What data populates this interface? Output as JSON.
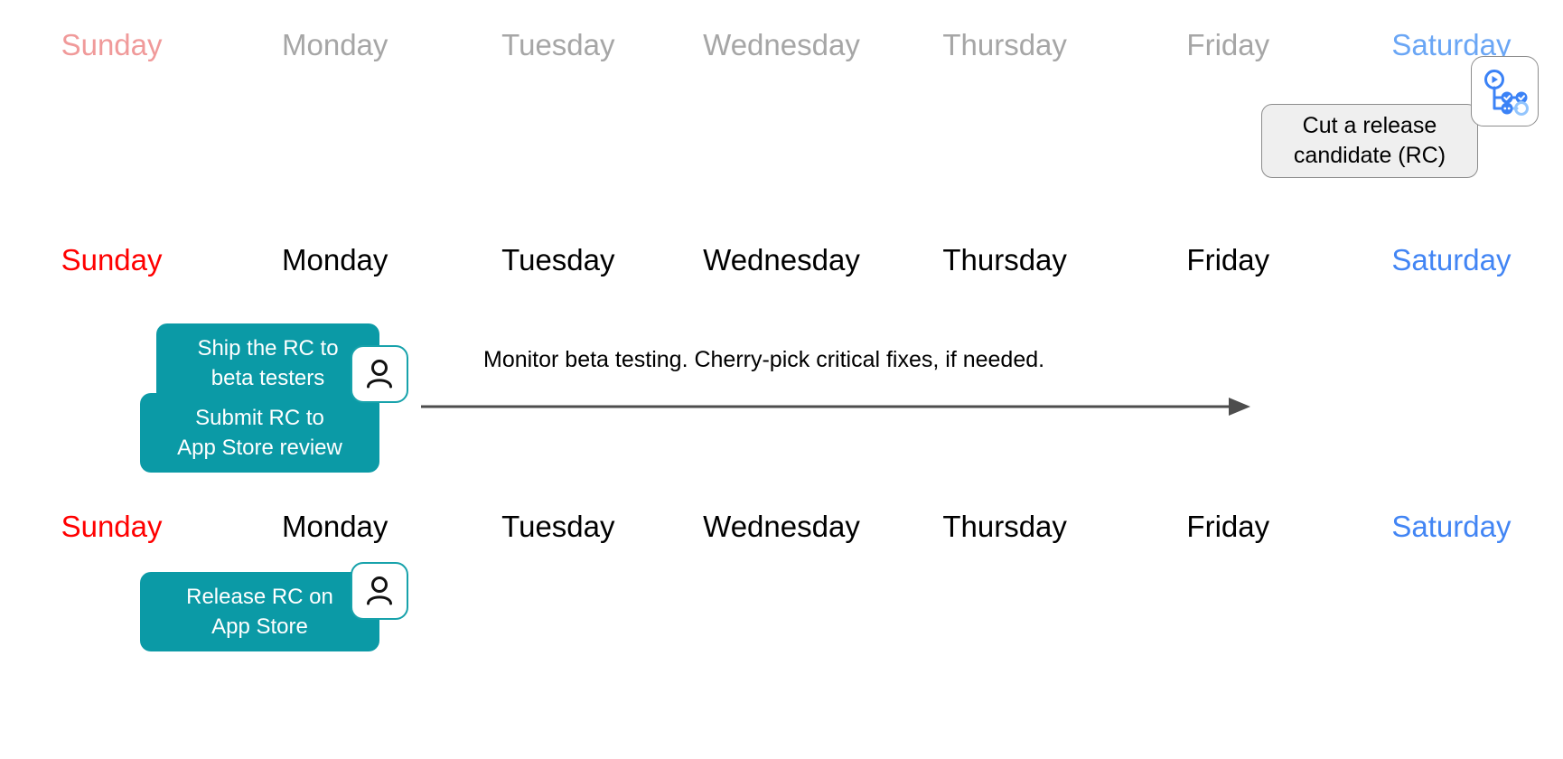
{
  "colors": {
    "teal": "#0b9aa6",
    "badge_border_teal": "#17a2ab",
    "red": "#ff0000",
    "muted_red": "#f09a9a",
    "blue": "#4285f4",
    "muted_blue": "#6aa6f5",
    "muted_gray": "#a6a6a6",
    "gray_box_fill": "#efefef",
    "gray_box_border": "#8c8c8c",
    "arrow": "#4d4d4d",
    "pipeline_icon": "#3b82f6"
  },
  "weeks": [
    {
      "id": "week-1",
      "state": "past",
      "days": [
        {
          "label": "Sunday",
          "style": "day-muted-red"
        },
        {
          "label": "Monday",
          "style": "day-muted-gray"
        },
        {
          "label": "Tuesday",
          "style": "day-muted-gray"
        },
        {
          "label": "Wednesday",
          "style": "day-muted-gray"
        },
        {
          "label": "Thursday",
          "style": "day-muted-gray"
        },
        {
          "label": "Friday",
          "style": "day-muted-gray"
        },
        {
          "label": "Saturday",
          "style": "day-muted-blue"
        }
      ]
    },
    {
      "id": "week-2",
      "state": "current",
      "days": [
        {
          "label": "Sunday",
          "style": "day-red"
        },
        {
          "label": "Monday",
          "style": "day-black"
        },
        {
          "label": "Tuesday",
          "style": "day-black"
        },
        {
          "label": "Wednesday",
          "style": "day-black"
        },
        {
          "label": "Thursday",
          "style": "day-black"
        },
        {
          "label": "Friday",
          "style": "day-black"
        },
        {
          "label": "Saturday",
          "style": "day-blue"
        }
      ]
    },
    {
      "id": "week-3",
      "state": "current",
      "days": [
        {
          "label": "Sunday",
          "style": "day-red"
        },
        {
          "label": "Monday",
          "style": "day-black"
        },
        {
          "label": "Tuesday",
          "style": "day-black"
        },
        {
          "label": "Wednesday",
          "style": "day-black"
        },
        {
          "label": "Thursday",
          "style": "day-black"
        },
        {
          "label": "Friday",
          "style": "day-black"
        },
        {
          "label": "Saturday",
          "style": "day-blue"
        }
      ]
    }
  ],
  "tasks": {
    "cut_release_candidate": {
      "line1": "Cut a release",
      "line2": "candidate (RC)",
      "day": "Saturday",
      "week": "week-1",
      "owner_icon": "pipeline-icon"
    },
    "ship_rc_to_beta": {
      "line1": "Ship the RC to",
      "line2": "beta testers",
      "day": "Monday",
      "week": "week-2",
      "owner_icon": "person-icon"
    },
    "submit_rc_review": {
      "line1": "Submit RC to",
      "line2": "App Store review",
      "day": "Monday",
      "week": "week-2"
    },
    "release_rc": {
      "line1": "Release RC on",
      "line2": "App Store",
      "day": "Monday",
      "week": "week-3",
      "owner_icon": "person-icon"
    }
  },
  "annotations": {
    "monitor_beta": {
      "text": "Monitor beta testing. Cherry-pick critical fixes, if needed.",
      "week": "week-2",
      "arrow": "right-arrow"
    }
  }
}
